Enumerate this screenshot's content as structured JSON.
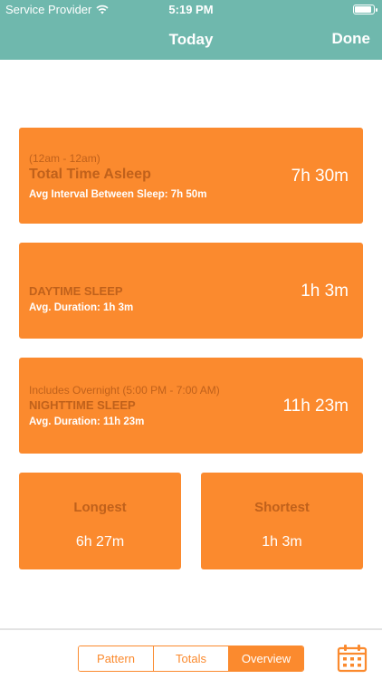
{
  "status_bar": {
    "carrier": "Service Provider",
    "time": "5:19 PM"
  },
  "nav": {
    "title": "Today",
    "done_label": "Done"
  },
  "total": {
    "range": "(12am - 12am)",
    "label": "Total Time Asleep",
    "detail": "Avg Interval Between Sleep:  7h 50m",
    "value": "7h 30m"
  },
  "daytime": {
    "label": "DAYTIME SLEEP",
    "detail": "Avg. Duration:  1h  3m",
    "value": "1h  3m"
  },
  "nighttime": {
    "range": "Includes Overnight (5:00 PM - 7:00 AM)",
    "label": "NIGHTTIME SLEEP",
    "detail": "Avg. Duration: 11h 23m",
    "value": "11h 23m"
  },
  "longest": {
    "label": "Longest",
    "value": "6h 27m"
  },
  "shortest": {
    "label": "Shortest",
    "value": "1h  3m"
  },
  "tabs": [
    "Pattern",
    "Totals",
    "Overview"
  ],
  "active_tab": "Overview",
  "icons": {
    "calendar": "calendar-icon",
    "wifi": "wifi-icon",
    "battery": "battery-icon"
  },
  "colors": {
    "accent": "#fb8a2e",
    "nav": "#6fb8ad",
    "muted_label": "#c0611b"
  }
}
